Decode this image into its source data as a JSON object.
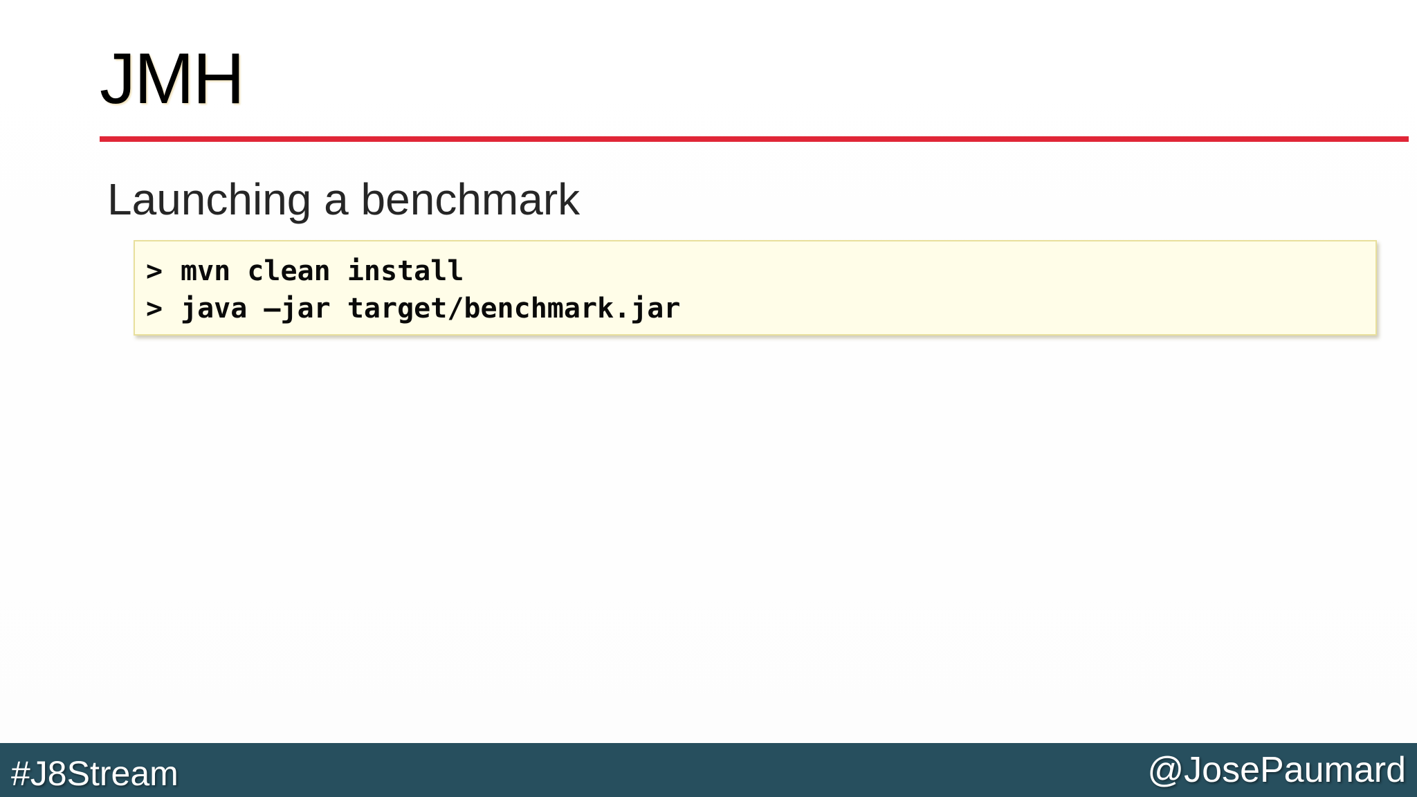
{
  "slide": {
    "title": "JMH",
    "subtitle": "Launching a benchmark",
    "code_lines": [
      {
        "prompt": ">",
        "command": "mvn clean install"
      },
      {
        "prompt": ">",
        "command": "java –jar target/benchmark.jar"
      }
    ]
  },
  "footer": {
    "hashtag": "#J8Stream",
    "handle": "@JosePaumard"
  },
  "colors": {
    "accent_rule": "#e02637",
    "footer_background": "#274f5e",
    "code_background": "#fffde8"
  }
}
